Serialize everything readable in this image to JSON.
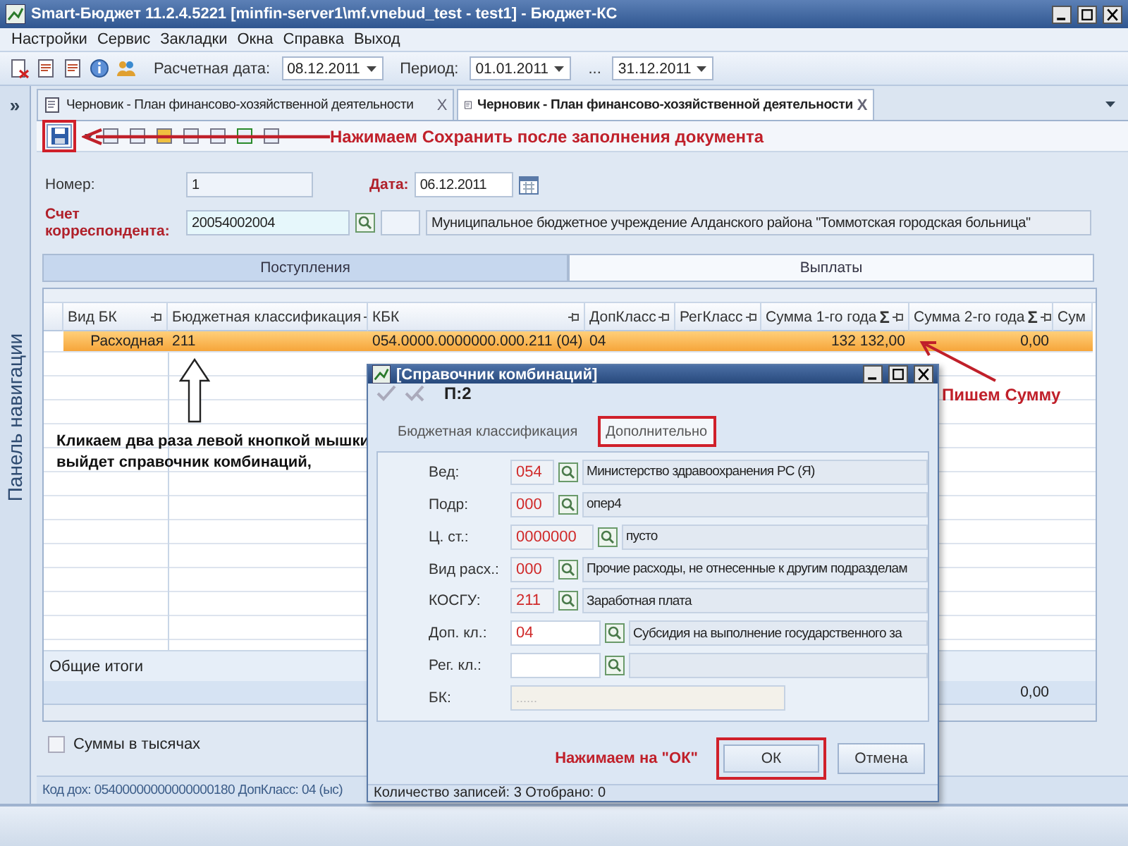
{
  "window": {
    "title": "Smart-Бюджет 11.2.4.5221 [minfin-server1\\mf.vnebud_test - test1] - Бюджет-КС"
  },
  "menu": [
    "Настройки",
    "Сервис",
    "Закладки",
    "Окна",
    "Справка",
    "Выход"
  ],
  "toolbar": {
    "calc_date_label": "Расчетная дата:",
    "calc_date": "08.12.2011",
    "period_label": "Период:",
    "period_from": "01.01.2011",
    "period_sep": "...",
    "period_to": "31.12.2011"
  },
  "nav_panel": {
    "title": "Панель навигации",
    "expand": "»"
  },
  "doc_tabs": [
    {
      "title": "Черновик - План финансово-хозяйственной деятельности",
      "selected": false,
      "close": "X"
    },
    {
      "title": "Черновик - План финансово-хозяйственной деятельности",
      "selected": true,
      "close": "X"
    }
  ],
  "doc_toolbar": {
    "save_highlighted": true
  },
  "form": {
    "number_label": "Номер:",
    "number": "1",
    "date_label": "Дата:",
    "date": "06.12.2011",
    "account_label": "Счет корреспондента:",
    "account": "20054002004",
    "org": "Муниципальное бюджетное учреждение Алданского района \"Томмотская городская больница\""
  },
  "section_tabs": [
    {
      "label": "Поступления",
      "selected": false
    },
    {
      "label": "Выплаты",
      "selected": true
    }
  ],
  "grid": {
    "columns": [
      {
        "label": "Вид БК"
      },
      {
        "label": "Бюджетная классификация"
      },
      {
        "label": "КБК"
      },
      {
        "label": "ДопКласс"
      },
      {
        "label": "РегКласс"
      },
      {
        "label": "Сумма 1-го года",
        "sum_sign": "Σ"
      },
      {
        "label": "Сумма 2-го года",
        "sum_sign": "Σ",
        "total": "0,00"
      },
      {
        "label": "Сум"
      }
    ],
    "rows": [
      {
        "selected": true,
        "cells": [
          "Расходная",
          "211",
          "054.0000.0000000.000.211 (04)",
          "04",
          "",
          "132 132,00",
          "0,00"
        ]
      }
    ],
    "totals_label": "Общие итоги"
  },
  "amounts_in_thousands": {
    "label": "Суммы в тысячах",
    "checked": false
  },
  "status_bar": "Код дох: 05400000000000000180 ДопКласс: 04 (ыс)",
  "dialog": {
    "title": "[Справочник комбинаций]",
    "record": "П:2",
    "tabs": [
      {
        "label": "Бюджетная классификация",
        "selected": false,
        "highlighted": false
      },
      {
        "label": "Дополнительно",
        "selected": true,
        "highlighted": true
      }
    ],
    "fields": [
      {
        "kind": "lookup",
        "label": "Вед:",
        "code": "054",
        "description": "Министерство здравоохранения РС (Я)"
      },
      {
        "kind": "lookup",
        "label": "Подр:",
        "code": "000",
        "description": "опер4"
      },
      {
        "kind": "lookup",
        "label": "Ц. ст.:",
        "code": "0000000",
        "description": "пусто"
      },
      {
        "kind": "lookup",
        "label": "Вид расх.:",
        "code": "000",
        "description": "Прочие расходы, не отнесенные к другим подразделам"
      },
      {
        "kind": "lookup",
        "label": "КОСГУ:",
        "code": "211",
        "description": "Заработная плата"
      },
      {
        "kind": "edit",
        "label": "Доп. кл.:",
        "code": "04",
        "description": "Субсидия на выполнение государственного за"
      },
      {
        "kind": "edit",
        "label": "Рег. кл.:"
      },
      {
        "kind": "readonly",
        "label": "БК:",
        "code": "......"
      }
    ],
    "buttons": [
      {
        "label": "ОК",
        "highlighted": true
      },
      {
        "label": "Отмена",
        "highlighted": false
      }
    ],
    "status": "Количество записей: 3 Отобрано: 0"
  },
  "annotations": {
    "save_hint": "Нажимаем Сохранить после заполнения документа",
    "sum_hint": "Пишем Сумму",
    "click_hint": "Кликаем два раза левой кнопкой мышки выйдет справочник комбинаций,",
    "ok_hint": "Нажимаем на \"ОК\""
  }
}
